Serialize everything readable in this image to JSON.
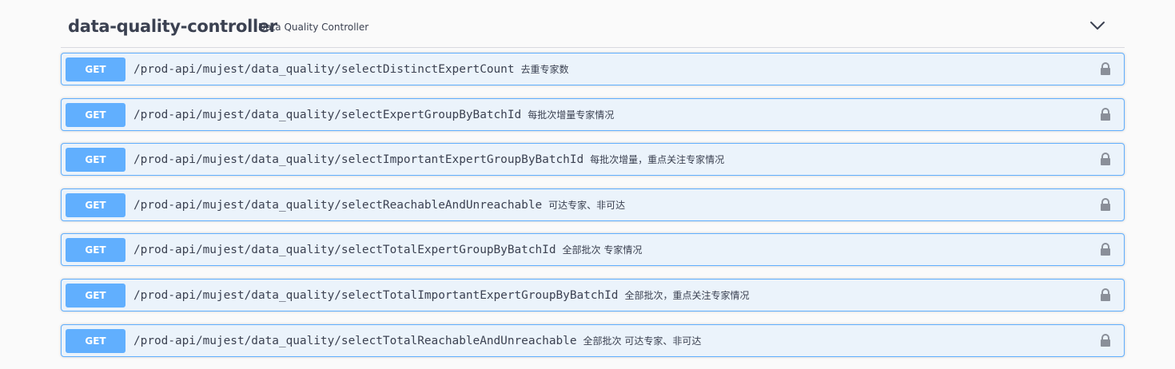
{
  "section": {
    "title": "data-quality-controller",
    "description": "Data Quality Controller",
    "toggle_icon": "chevron-down-icon"
  },
  "colors": {
    "get_accent": "#61affe",
    "get_background": "#ebf3fb",
    "text": "#3b4151",
    "lock_icon": "#8a8f99"
  },
  "operations": [
    {
      "method": "GET",
      "path": "/prod-api/mujest/data_quality/selectDistinctExpertCount",
      "summary": "去重专家数",
      "lock_icon": "lock-icon"
    },
    {
      "method": "GET",
      "path": "/prod-api/mujest/data_quality/selectExpertGroupByBatchId",
      "summary": "每批次增量专家情况",
      "lock_icon": "lock-icon"
    },
    {
      "method": "GET",
      "path": "/prod-api/mujest/data_quality/selectImportantExpertGroupByBatchId",
      "summary": "每批次增量，重点关注专家情况",
      "lock_icon": "lock-icon"
    },
    {
      "method": "GET",
      "path": "/prod-api/mujest/data_quality/selectReachableAndUnreachable",
      "summary": "可达专家、非可达",
      "lock_icon": "lock-icon"
    },
    {
      "method": "GET",
      "path": "/prod-api/mujest/data_quality/selectTotalExpertGroupByBatchId",
      "summary": "全部批次 专家情况",
      "lock_icon": "lock-icon"
    },
    {
      "method": "GET",
      "path": "/prod-api/mujest/data_quality/selectTotalImportantExpertGroupByBatchId",
      "summary": "全部批次，重点关注专家情况",
      "lock_icon": "lock-icon"
    },
    {
      "method": "GET",
      "path": "/prod-api/mujest/data_quality/selectTotalReachableAndUnreachable",
      "summary": "全部批次 可达专家、非可达",
      "lock_icon": "lock-icon"
    }
  ]
}
